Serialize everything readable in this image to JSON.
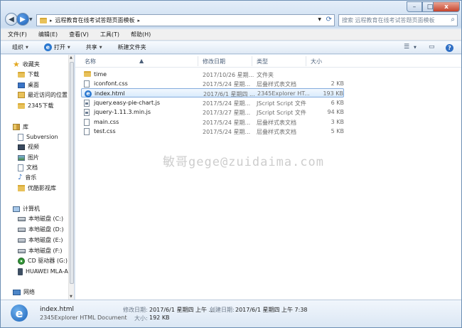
{
  "address": {
    "path": "远程教育在线考试答题页面模板",
    "search_placeholder": "搜索 远程教育在线考试答题页面模板"
  },
  "window_controls": {
    "min": "–",
    "max": "□",
    "close": "x"
  },
  "menu": [
    "文件(F)",
    "编辑(E)",
    "查看(V)",
    "工具(T)",
    "帮助(H)"
  ],
  "toolbar": {
    "organize": "组织",
    "open": "打开",
    "share": "共享",
    "new_folder": "新建文件夹"
  },
  "sidebar": {
    "favorites": "收藏夹",
    "fav_items": [
      "下载",
      "桌面",
      "最近访问的位置",
      "2345下载"
    ],
    "library": "库",
    "lib_items": [
      "Subversion",
      "视频",
      "图片",
      "文档",
      "音乐",
      "优酷影视库"
    ],
    "computer": "计算机",
    "drives": [
      "本地磁盘 (C:)",
      "本地磁盘 (D:)",
      "本地磁盘 (E:)",
      "本地磁盘 (F:)",
      "CD 驱动器 (G:) H",
      "HUAWEI MLA-A"
    ],
    "network": "网络"
  },
  "columns": {
    "name": "名称",
    "date": "修改日期",
    "type": "类型",
    "size": "大小"
  },
  "files": [
    {
      "name": "time",
      "date": "2017/10/26 星期...",
      "type": "文件夹",
      "size": "",
      "icon": "folder-icon"
    },
    {
      "name": "iconfont.css",
      "date": "2017/5/24 星期...",
      "type": "层叠样式表文档",
      "size": "2 KB",
      "icon": "css-file-icon"
    },
    {
      "name": "index.html",
      "date": "2017/6/1 星期四 ...",
      "type": "2345Explorer HT...",
      "size": "193 KB",
      "icon": "html-file-icon"
    },
    {
      "name": "jquery.easy-pie-chart.js",
      "date": "2017/5/24 星期...",
      "type": "JScript Script 文件",
      "size": "6 KB",
      "icon": "js-file-icon"
    },
    {
      "name": "jquery-1.11.3.min.js",
      "date": "2017/3/27 星期...",
      "type": "JScript Script 文件",
      "size": "94 KB",
      "icon": "js-file-icon"
    },
    {
      "name": "main.css",
      "date": "2017/5/24 星期...",
      "type": "层叠样式表文档",
      "size": "3 KB",
      "icon": "css-file-icon"
    },
    {
      "name": "test.css",
      "date": "2017/5/24 星期...",
      "type": "层叠样式表文档",
      "size": "5 KB",
      "icon": "css-file-icon"
    }
  ],
  "watermark": "敏哥gege@zuidaima.com",
  "details": {
    "name": "index.html",
    "type": "2345Explorer HTML Document",
    "modified_label": "修改日期:",
    "modified_value": "2017/6/1 星期四 上午 ...",
    "created_label": "创建日期:",
    "created_value": "2017/6/1 星期四 上午 7:38",
    "size_label": "大小:",
    "size_value": "192 KB"
  }
}
